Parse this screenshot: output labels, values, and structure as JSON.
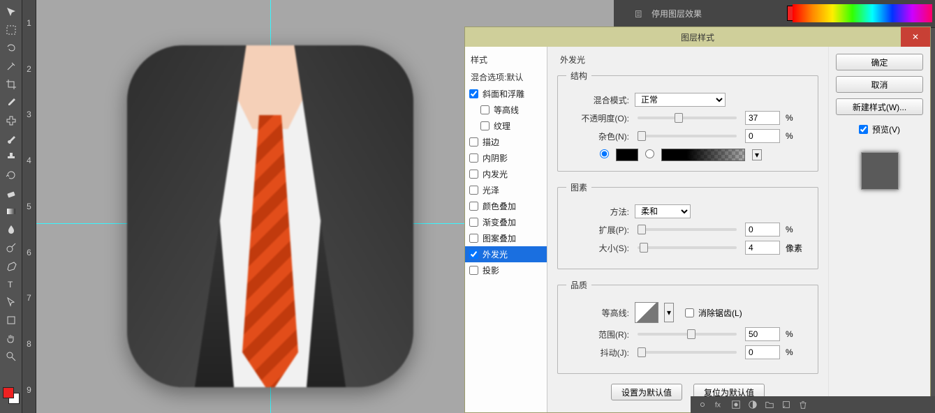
{
  "right_dock": {
    "label": "停用图层效果"
  },
  "dialog": {
    "title": "图层样式",
    "close_glyph": "✕",
    "styles_col": {
      "header": "样式",
      "blend_default": "混合选项:默认",
      "items": [
        {
          "key": "bevel",
          "label": "斜面和浮雕",
          "checked": true,
          "indent": false
        },
        {
          "key": "contour",
          "label": "等高线",
          "checked": false,
          "indent": true
        },
        {
          "key": "texture",
          "label": "纹理",
          "checked": false,
          "indent": true
        },
        {
          "key": "stroke",
          "label": "描边",
          "checked": false,
          "indent": false
        },
        {
          "key": "innersh",
          "label": "内阴影",
          "checked": false,
          "indent": false
        },
        {
          "key": "innergl",
          "label": "内发光",
          "checked": false,
          "indent": false
        },
        {
          "key": "satin",
          "label": "光泽",
          "checked": false,
          "indent": false
        },
        {
          "key": "colorov",
          "label": "颜色叠加",
          "checked": false,
          "indent": false
        },
        {
          "key": "gradov",
          "label": "渐变叠加",
          "checked": false,
          "indent": false
        },
        {
          "key": "pattov",
          "label": "图案叠加",
          "checked": false,
          "indent": false
        },
        {
          "key": "outergl",
          "label": "外发光",
          "checked": true,
          "indent": false,
          "active": true
        },
        {
          "key": "dropsh",
          "label": "投影",
          "checked": false,
          "indent": false
        }
      ]
    },
    "section_title": "外发光",
    "structure": {
      "legend": "结构",
      "blend_mode_label": "混合模式:",
      "blend_mode_value": "正常",
      "opacity_label": "不透明度(O):",
      "opacity_value": "37",
      "opacity_unit": "%",
      "noise_label": "杂色(N):",
      "noise_value": "0",
      "noise_unit": "%"
    },
    "elements": {
      "legend": "图素",
      "technique_label": "方法:",
      "technique_value": "柔和",
      "spread_label": "扩展(P):",
      "spread_value": "0",
      "spread_unit": "%",
      "size_label": "大小(S):",
      "size_value": "4",
      "size_unit": "像素"
    },
    "quality": {
      "legend": "品质",
      "contour_label": "等高线:",
      "antialias_label": "消除锯齿(L)",
      "range_label": "范围(R):",
      "range_value": "50",
      "range_unit": "%",
      "jitter_label": "抖动(J):",
      "jitter_value": "0",
      "jitter_unit": "%"
    },
    "defaults": {
      "set": "设置为默认值",
      "reset": "复位为默认值"
    },
    "buttons": {
      "ok": "确定",
      "cancel": "取消",
      "new_style": "新建样式(W)...",
      "preview": "预览(V)"
    }
  },
  "ruler_marks": [
    "1",
    "2",
    "3",
    "4",
    "5",
    "6",
    "7",
    "8",
    "9"
  ],
  "colors": {
    "fg": "#e22222",
    "bg": "#ffffff"
  }
}
